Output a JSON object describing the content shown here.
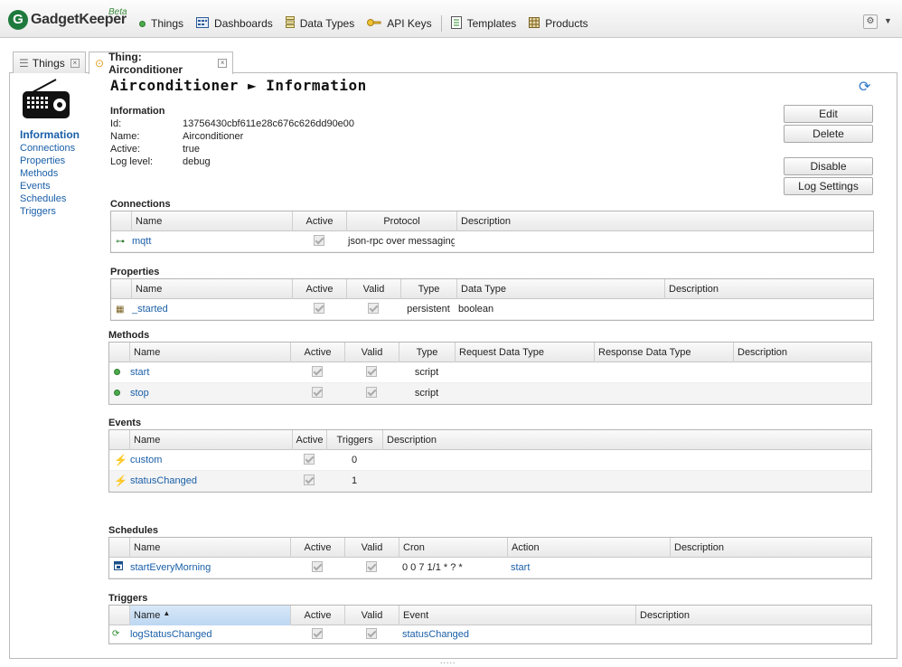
{
  "app": {
    "name": "GadgetKeeper",
    "badge": "Beta"
  },
  "nav": [
    {
      "label": "Things",
      "icon": "green-dot-icon"
    },
    {
      "label": "Dashboards",
      "icon": "dashboard-icon"
    },
    {
      "label": "Data Types",
      "icon": "stack-icon"
    },
    {
      "label": "API Keys",
      "icon": "key-icon"
    },
    {
      "label": "Templates",
      "icon": "list-icon"
    },
    {
      "label": "Products",
      "icon": "grid-icon"
    }
  ],
  "tabs": [
    {
      "label": "Things"
    },
    {
      "label": "Thing: Airconditioner"
    }
  ],
  "page_title": "Airconditioner ► Information",
  "sidebar": [
    "Information",
    "Connections",
    "Properties",
    "Methods",
    "Events",
    "Schedules",
    "Triggers"
  ],
  "info": {
    "heading": "Information",
    "rows": [
      {
        "k": "Id:",
        "v": "13756430cbf611e28c676c626dd90e00"
      },
      {
        "k": "Name:",
        "v": "Airconditioner"
      },
      {
        "k": "Active:",
        "v": "true"
      },
      {
        "k": "Log level:",
        "v": "debug"
      }
    ]
  },
  "buttons": {
    "edit": "Edit",
    "delete": "Delete",
    "disable": "Disable",
    "log_settings": "Log Settings"
  },
  "connections": {
    "title": "Connections",
    "headers": [
      "Name",
      "Active",
      "Protocol",
      "Description"
    ],
    "rows": [
      {
        "name": "mqtt",
        "active": true,
        "protocol": "json-rpc over messaging",
        "description": ""
      }
    ]
  },
  "properties": {
    "title": "Properties",
    "headers": [
      "Name",
      "Active",
      "Valid",
      "Type",
      "Data Type",
      "Description"
    ],
    "rows": [
      {
        "name": "_started",
        "active": true,
        "valid": true,
        "type": "persistent",
        "data_type": "boolean",
        "description": ""
      }
    ]
  },
  "methods": {
    "title": "Methods",
    "headers": [
      "Name",
      "Active",
      "Valid",
      "Type",
      "Request Data Type",
      "Response Data Type",
      "Description"
    ],
    "rows": [
      {
        "name": "start",
        "active": true,
        "valid": true,
        "type": "script"
      },
      {
        "name": "stop",
        "active": true,
        "valid": true,
        "type": "script"
      }
    ]
  },
  "events": {
    "title": "Events",
    "headers": [
      "Name",
      "Active",
      "Triggers",
      "Description"
    ],
    "rows": [
      {
        "name": "custom",
        "active": true,
        "triggers": "0"
      },
      {
        "name": "statusChanged",
        "active": true,
        "triggers": "1"
      }
    ]
  },
  "schedules": {
    "title": "Schedules",
    "headers": [
      "Name",
      "Active",
      "Valid",
      "Cron",
      "Action",
      "Description"
    ],
    "rows": [
      {
        "name": "startEveryMorning",
        "active": true,
        "valid": true,
        "cron": "0 0 7 1/1 * ? *",
        "action": "start"
      }
    ]
  },
  "triggers": {
    "title": "Triggers",
    "headers": [
      "Name",
      "Active",
      "Valid",
      "Event",
      "Description"
    ],
    "rows": [
      {
        "name": "logStatusChanged",
        "active": true,
        "valid": true,
        "event": "statusChanged"
      }
    ]
  },
  "colors": {
    "link": "#1a5fa8",
    "brand_green": "#1e7a3c",
    "sorted_header": "#bdd7f2"
  }
}
